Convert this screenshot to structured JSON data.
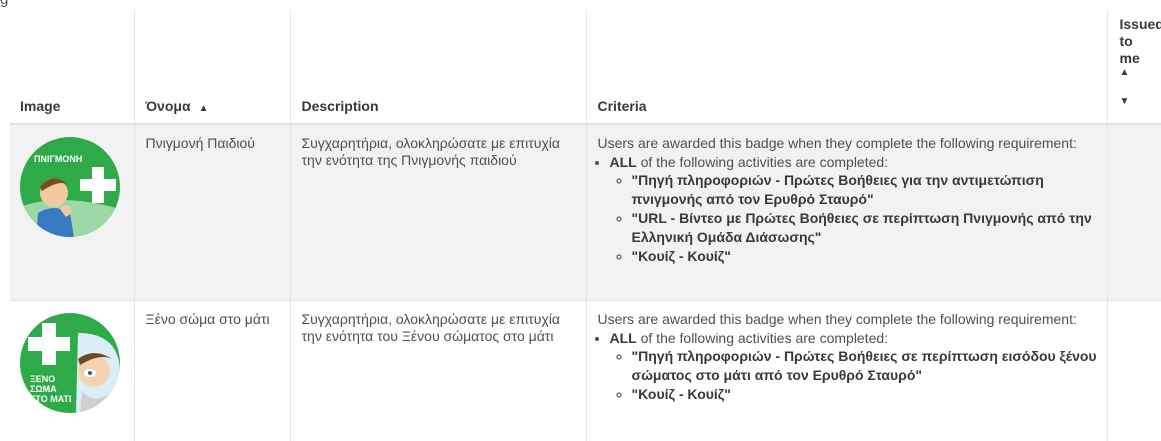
{
  "fragment_text": "g",
  "headers": {
    "image": "Image",
    "name": "Όνομα",
    "description": "Description",
    "criteria": "Criteria",
    "issued": "Issued to me"
  },
  "sort_icons": {
    "name": "sort-ascending-icon",
    "issued_up": "sort-up-icon",
    "issued_down": "sort-down-icon"
  },
  "rows": [
    {
      "badge_text": "ΠΝΙΓΜΟΝΗ",
      "badge_color": "#2eaa48",
      "name": "Πνιγμονή Παιδιού",
      "description": "Συγχαρητήρια, ολοκληρώσατε με επιτυχία την ενότητα της Πνιγμονής παιδιού",
      "criteria_intro": "Users are awarded this badge when they complete the following requirement:",
      "criteria_all": "ALL",
      "criteria_all_rest": " of the following activities are completed:",
      "activities": [
        "\"Πηγή πληροφοριών - Πρώτες Βοήθειες για την αντιμετώπιση πνιγμονής από τον Ερυθρό Σταυρό\"",
        "\"URL - Βίντεο με Πρώτες Βοήθειες σε περίπτωση Πνιγμονής από την Ελληνική Ομάδα Διάσωσης\"",
        "\"Κουίζ - Κουίζ\""
      ]
    },
    {
      "badge_text_lines": [
        "ΞΕΝΟ",
        "ΣΩΜΑ",
        "ΣΤΟ ΜΑΤΙ"
      ],
      "badge_color": "#2eaa48",
      "name": "Ξένο σώμα στο μάτι",
      "description": "Συγχαρητήρια, ολοκληρώσατε με επιτυχία την ενότητα του Ξένου σώματος στο μάτι",
      "criteria_intro": "Users are awarded this badge when they complete the following requirement:",
      "criteria_all": "ALL",
      "criteria_all_rest": " of the following activities are completed:",
      "activities": [
        "\"Πηγή πληροφοριών - Πρώτες Βοήθειες σε περίπτωση εισόδου ξένου σώματος στο μάτι από τον Ερυθρό Σταυρό\"",
        "\"Κουίζ - Κουίζ\""
      ]
    }
  ]
}
